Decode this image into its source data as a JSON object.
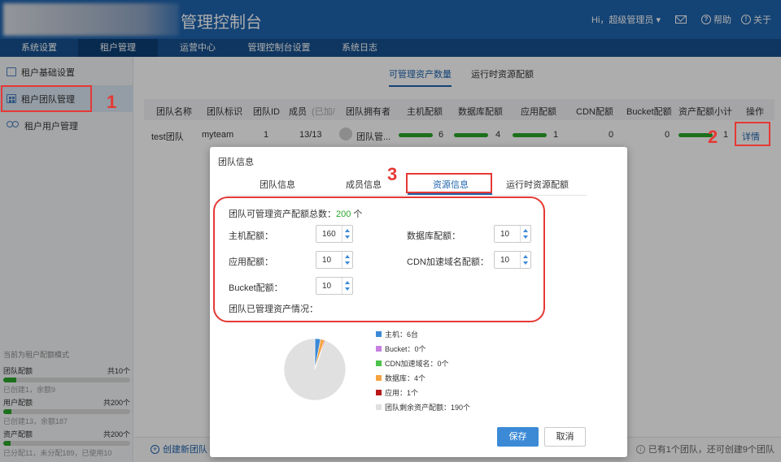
{
  "header": {
    "title": "管理控制台",
    "user": "Hi，超级管理员",
    "help": "帮助",
    "about": "关于"
  },
  "nav": {
    "tabs": [
      {
        "label": "系统设置"
      },
      {
        "label": "租户管理"
      },
      {
        "label": "运营中心"
      },
      {
        "label": "管理控制台设置"
      },
      {
        "label": "系统日志"
      }
    ],
    "active": "租户管理"
  },
  "sidebar": {
    "items": [
      {
        "label": "租户基础设置"
      },
      {
        "label": "租户团队管理"
      },
      {
        "label": "租户用户管理"
      }
    ],
    "quota_mode": "当前为租户配额模式",
    "quotas": [
      {
        "label": "团队配额",
        "total": "共10个",
        "sub": "已创建1，余额9",
        "fill": 0.1
      },
      {
        "label": "用户配额",
        "total": "共200个",
        "sub": "已创建13，余额187",
        "fill": 0.065
      },
      {
        "label": "资产配额",
        "total": "共200个",
        "sub": "已分配11，未分配189，已使用10",
        "fill": 0.055
      }
    ]
  },
  "main": {
    "subtabs": [
      "可管理资产数量",
      "运行时资源配额"
    ],
    "columns": [
      "团队名称",
      "团队标识",
      "团队ID",
      "成员",
      "(已加/",
      "团队拥有者",
      "主机配额",
      "数据库配额",
      "应用配额",
      "CDN配额",
      "Bucket配额",
      "资产配额小计",
      "操作"
    ],
    "row": {
      "name": "test团队",
      "key": "myteam",
      "id": "1",
      "members": "13/13",
      "owner": "团队管...",
      "host": "6",
      "db": "4",
      "app": "1",
      "cdn": "0",
      "bucket": "0",
      "subtotal": "1",
      "action": "详情"
    },
    "host_fill": 0.0375,
    "create_team": "创建新团队",
    "footer_info": "已有1个团队，还可创建9个团队"
  },
  "modal": {
    "title": "团队信息",
    "tabs": [
      "团队信息",
      "成员信息",
      "资源信息",
      "运行时资源配额"
    ],
    "active_tab": "资源信息",
    "total_label": "团队可管理资产配额总数：",
    "total_value": "200",
    "total_unit": "个",
    "fields": {
      "host": {
        "label": "主机配额：",
        "value": "160"
      },
      "db": {
        "label": "数据库配额：",
        "value": "10"
      },
      "app": {
        "label": "应用配额：",
        "value": "10"
      },
      "cdn": {
        "label": "CDN加速域名配额：",
        "value": "10"
      },
      "bucket": {
        "label": "Bucket配额：",
        "value": "10"
      }
    },
    "used_label": "团队已管理资产情况：",
    "save": "保存",
    "cancel": "取消"
  },
  "chart_data": {
    "type": "pie",
    "slices": [
      {
        "label": "主机：6台",
        "value": 6,
        "color": "#3c8ad6"
      },
      {
        "label": "Bucket：0个",
        "value": 0,
        "color": "#c77fe0"
      },
      {
        "label": "CDN加速域名：0个",
        "value": 0,
        "color": "#4cc24c"
      },
      {
        "label": "数据库：4个",
        "value": 4,
        "color": "#f5a442"
      },
      {
        "label": "应用：1个",
        "value": 1,
        "color": "#b81818"
      },
      {
        "label": "团队剩余资产配额：190个",
        "value": 190,
        "color": "#e0e0e0"
      }
    ]
  },
  "annotations": [
    "1",
    "2",
    "3"
  ]
}
